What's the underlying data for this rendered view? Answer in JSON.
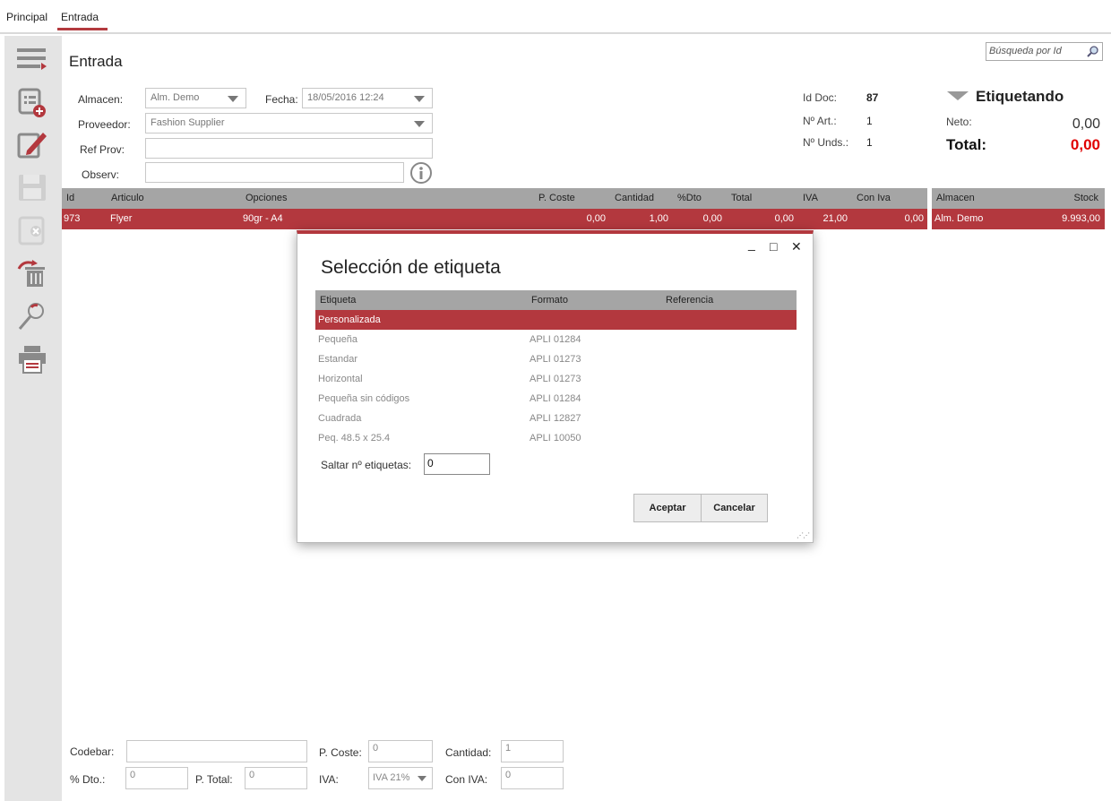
{
  "tabs": [
    "Principal",
    "Entrada"
  ],
  "page_title": "Entrada",
  "search": {
    "placeholder": "Búsqueda por Id"
  },
  "form": {
    "almacen_label": "Almacen:",
    "almacen_value": "Alm. Demo",
    "fecha_label": "Fecha:",
    "fecha_value": "18/05/2016 12:24",
    "proveedor_label": "Proveedor:",
    "proveedor_value": "Fashion Supplier",
    "refprov_label": "Ref Prov:",
    "refprov_value": "",
    "observ_label": "Observ:",
    "observ_value": ""
  },
  "summary": {
    "iddoc_label": "Id Doc:",
    "iddoc_value": "87",
    "nart_label": "Nº Art.:",
    "nart_value": "1",
    "nunds_label": "Nº Unds.:",
    "nunds_value": "1",
    "status": "Etiquetando",
    "neto_label": "Neto:",
    "neto_value": "0,00",
    "total_label": "Total:",
    "total_value": "0,00"
  },
  "grid": {
    "headers": [
      "Id",
      "Articulo",
      "Opciones",
      "P. Coste",
      "Cantidad",
      "%Dto",
      "Total",
      "IVA",
      "Con Iva"
    ],
    "row": [
      "973",
      "Flyer",
      "90gr - A4",
      "0,00",
      "1,00",
      "0,00",
      "0,00",
      "21,00",
      "0,00"
    ]
  },
  "stock": {
    "headers": [
      "Almacen",
      "Stock"
    ],
    "row": [
      "Alm. Demo",
      "9.993,00"
    ]
  },
  "dialog": {
    "title": "Selección de etiqueta",
    "minimize": "_",
    "maximize": "□",
    "close": "✕",
    "headers": [
      "Etiqueta",
      "Formato",
      "Referencia"
    ],
    "rows": [
      {
        "etiqueta": "Personalizada",
        "formato": ""
      },
      {
        "etiqueta": "Pequeña",
        "formato": "APLI 01284"
      },
      {
        "etiqueta": "Estandar",
        "formato": "APLI 01273"
      },
      {
        "etiqueta": "Horizontal",
        "formato": "APLI 01273"
      },
      {
        "etiqueta": "Pequeña sin códigos",
        "formato": "APLI 01284"
      },
      {
        "etiqueta": "Cuadrada",
        "formato": "APLI 12827"
      },
      {
        "etiqueta": "Peq. 48.5 x 25.4",
        "formato": "APLI 10050"
      }
    ],
    "saltar_label": "Saltar nº etiquetas:",
    "saltar_value": "0",
    "accept": "Aceptar",
    "cancel": "Cancelar"
  },
  "bottom": {
    "codebar_label": "Codebar:",
    "codebar_value": "",
    "pcoste_label": "P. Coste:",
    "pcoste_value": "0",
    "cantidad_label": "Cantidad:",
    "cantidad_value": "1",
    "dto_label": "% Dto.:",
    "dto_value": "0",
    "ptotal_label": "P. Total:",
    "ptotal_value": "0",
    "iva_label": "IVA:",
    "iva_value": "IVA 21%",
    "coniva_label": "Con IVA:",
    "coniva_value": "0"
  },
  "colors": {
    "accent": "#b3383e",
    "header_gray": "#a5a5a5",
    "sidebar": "#e4e4e4",
    "total_red": "#e00000"
  },
  "sidebar_icons": [
    "menu-icon",
    "new-document-icon",
    "edit-icon",
    "save-icon",
    "cancel-document-icon",
    "delete-icon",
    "search-icon",
    "print-icon"
  ]
}
